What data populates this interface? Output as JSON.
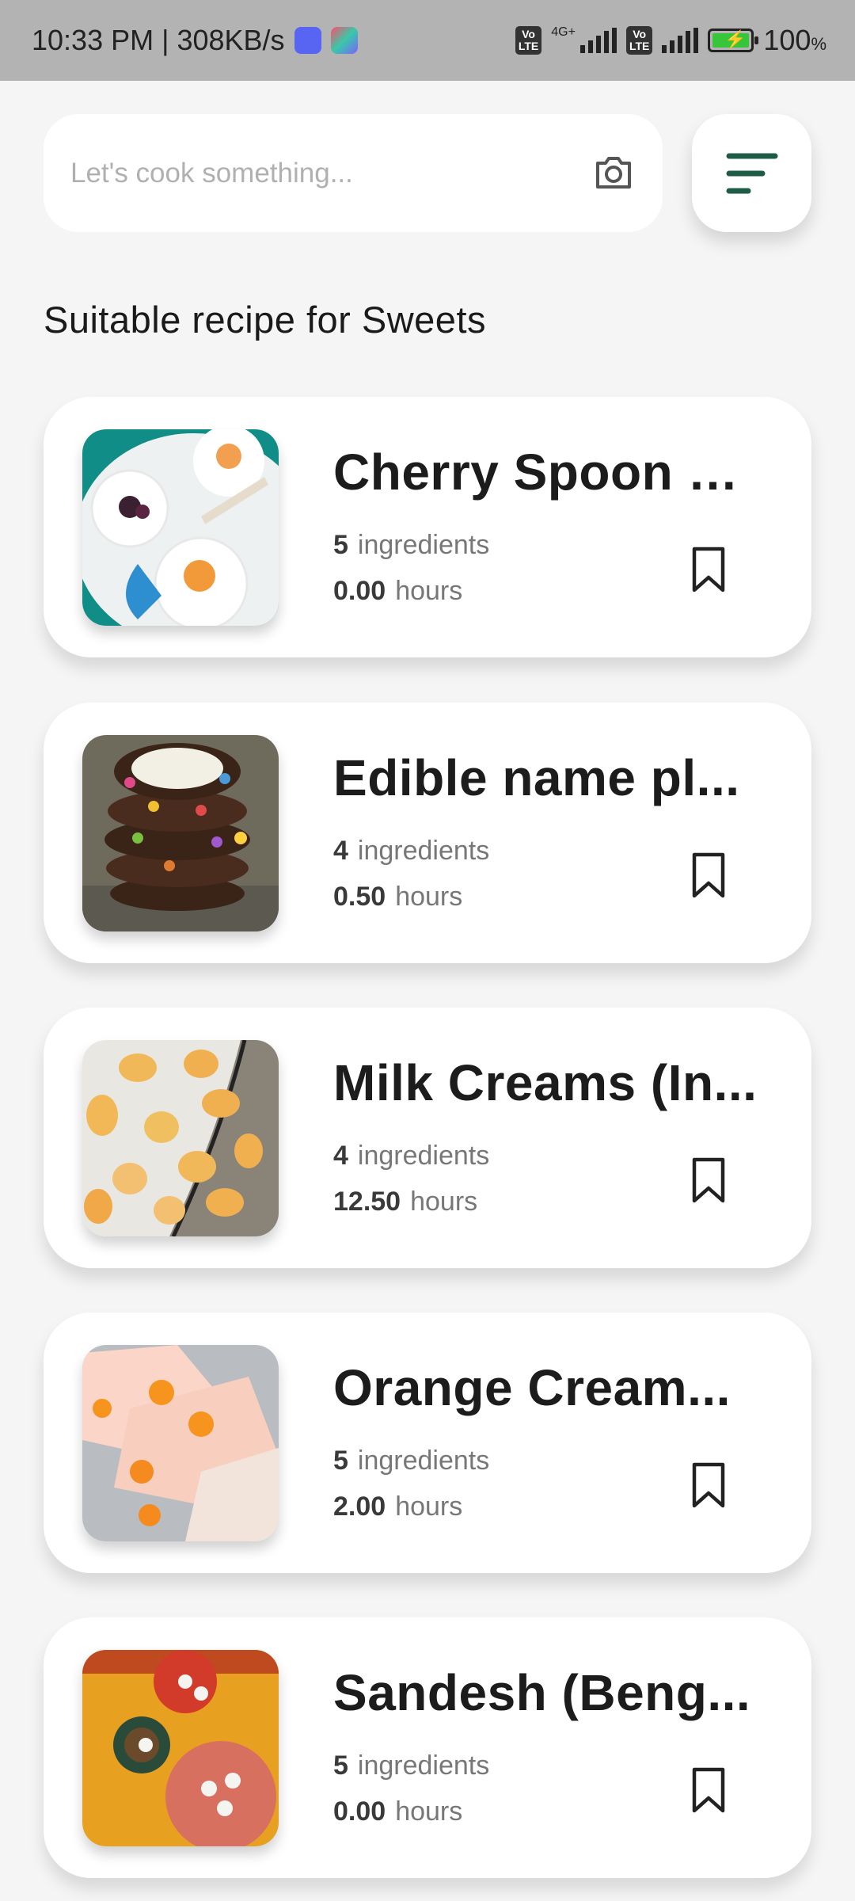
{
  "status_bar": {
    "time": "10:33 PM",
    "speed": "308KB/s",
    "network": "4G+",
    "volte_label": "Vo LTE",
    "battery": "100",
    "battery_unit": "%"
  },
  "search": {
    "placeholder": "Let's cook something..."
  },
  "section_title": "Suitable recipe for Sweets",
  "recipes": [
    {
      "title": "Cherry Spoon S...",
      "ingredients": "5",
      "ingredients_label": "ingredients",
      "hours": "0.00",
      "hours_label": "hours"
    },
    {
      "title": "Edible name pl...",
      "ingredients": "4",
      "ingredients_label": "ingredients",
      "hours": "0.50",
      "hours_label": "hours"
    },
    {
      "title": "Milk Creams (In...",
      "ingredients": "4",
      "ingredients_label": "ingredients",
      "hours": "12.50",
      "hours_label": "hours"
    },
    {
      "title": "Orange Cream...",
      "ingredients": "5",
      "ingredients_label": "ingredients",
      "hours": "2.00",
      "hours_label": "hours"
    },
    {
      "title": "Sandesh (Beng...",
      "ingredients": "5",
      "ingredients_label": "ingredients",
      "hours": "0.00",
      "hours_label": "hours"
    }
  ],
  "colors": {
    "accent": "#1f5c46",
    "background": "#f5f5f5",
    "status_bar": "#b3b3b3"
  },
  "icons": [
    "camera-icon",
    "filter-icon",
    "bookmark-icon",
    "discord-icon",
    "photos-icon",
    "battery-icon",
    "signal-icon"
  ]
}
